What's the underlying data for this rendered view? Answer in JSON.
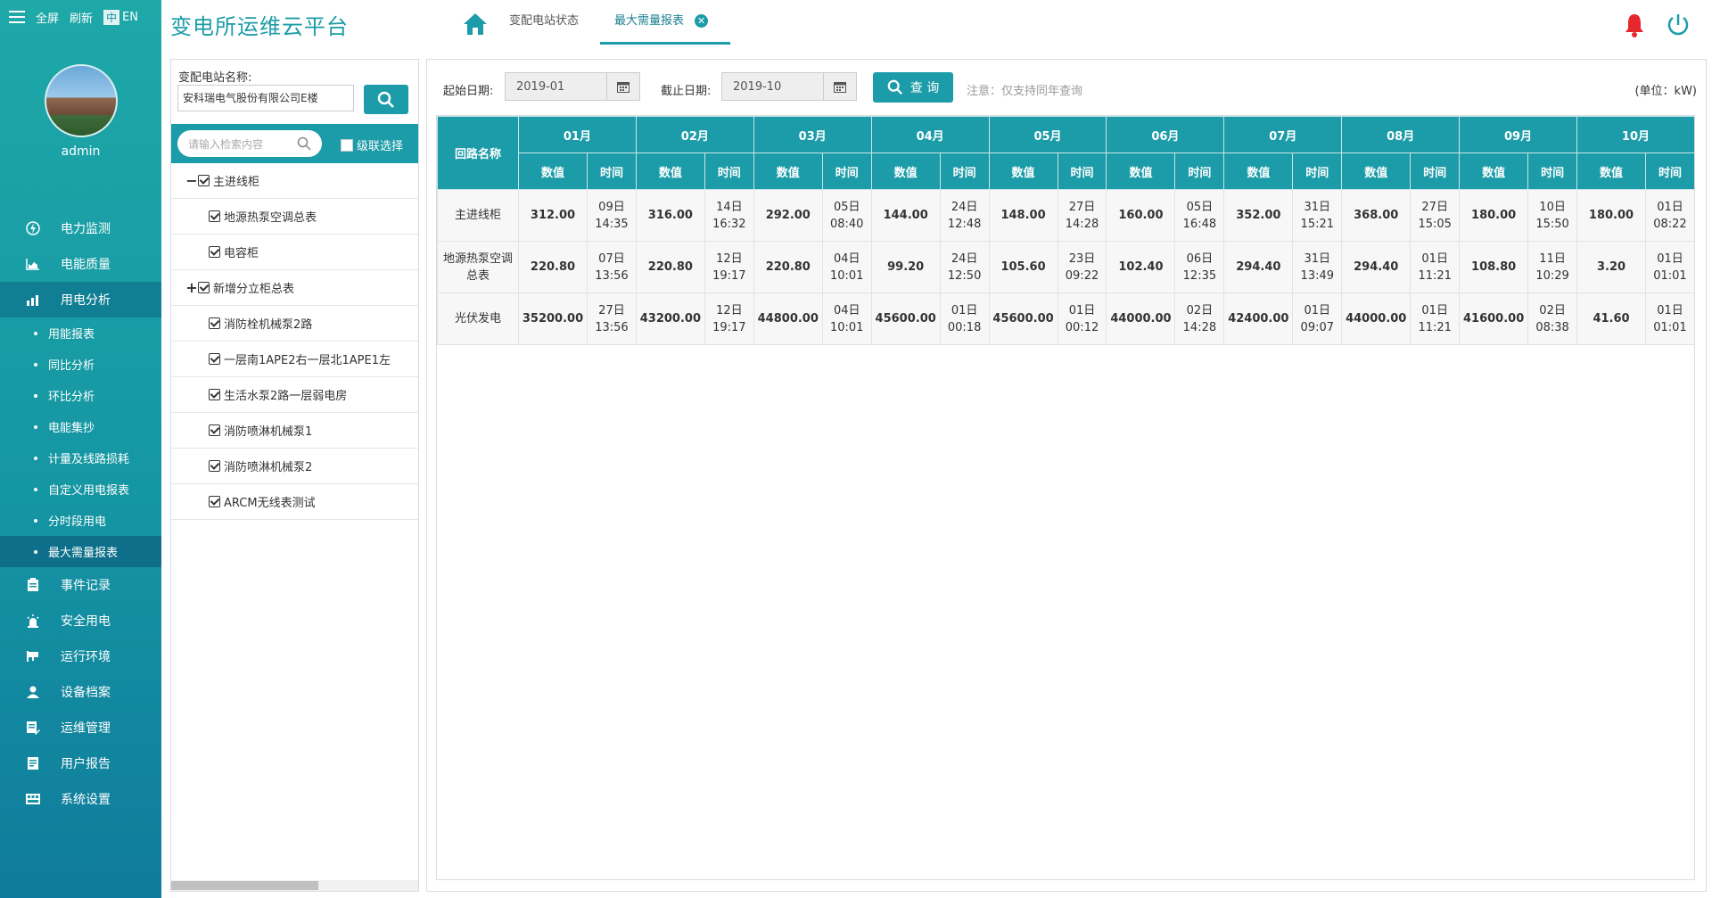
{
  "sidebar": {
    "fullscreen": "全屏",
    "refresh": "刷新",
    "lang_zh": "中",
    "lang_en": "EN",
    "username": "admin",
    "nav": [
      {
        "label": "电力监测",
        "icon": "lightning-icon"
      },
      {
        "label": "电能质量",
        "icon": "chart-area-icon"
      },
      {
        "label": "用电分析",
        "icon": "bar-chart-icon"
      }
    ],
    "sub": [
      "用能报表",
      "同比分析",
      "环比分析",
      "电能集抄",
      "计量及线路损耗",
      "自定义用电报表",
      "分时段用电",
      "最大需量报表"
    ],
    "nav2": [
      {
        "label": "事件记录",
        "icon": "clipboard-icon"
      },
      {
        "label": "安全用电",
        "icon": "alarm-light-icon"
      },
      {
        "label": "运行环境",
        "icon": "camera-icon"
      },
      {
        "label": "设备档案",
        "icon": "user-group-icon"
      },
      {
        "label": "运维管理",
        "icon": "edit-doc-icon"
      },
      {
        "label": "用户报告",
        "icon": "report-icon"
      },
      {
        "label": "系统设置",
        "icon": "keyboard-icon"
      }
    ]
  },
  "header": {
    "title": "变电所运维云平台",
    "tab1": "变配电站状态",
    "tab2": "最大需量报表",
    "accent": "#1c9ca8"
  },
  "tree": {
    "label": "变配电站名称:",
    "station": "安科瑞电气股份有限公司E楼",
    "search_placeholder": "请输入检索内容",
    "cascade": "级联选择",
    "nodes": [
      {
        "label": "主进线柜",
        "expander": "−",
        "level": 1
      },
      {
        "label": "地源热泵空调总表",
        "expander": "",
        "level": 2
      },
      {
        "label": "电容柜",
        "expander": "",
        "level": 2
      },
      {
        "label": "新增分立柜总表",
        "expander": "+",
        "level": 1
      },
      {
        "label": "消防栓机械泵2路",
        "expander": "",
        "level": 2
      },
      {
        "label": "一层南1APE2右一层北1APE1左",
        "expander": "",
        "level": 2
      },
      {
        "label": "生活水泵2路一层弱电房",
        "expander": "",
        "level": 2
      },
      {
        "label": "消防喷淋机械泵1",
        "expander": "",
        "level": 2
      },
      {
        "label": "消防喷淋机械泵2",
        "expander": "",
        "level": 2
      },
      {
        "label": "ARCM无线表测试",
        "expander": "",
        "level": 2
      }
    ]
  },
  "filter": {
    "start_label": "起始日期:",
    "start_value": "2019-01",
    "end_label": "截止日期:",
    "end_value": "2019-10",
    "query": "查 询",
    "note": "注意：仅支持同年查询",
    "unit": "(单位：kW)"
  },
  "table": {
    "name_header": "回路名称",
    "value_header": "数值",
    "time_header": "时间",
    "months": [
      "01月",
      "02月",
      "03月",
      "04月",
      "05月",
      "06月",
      "07月",
      "08月",
      "09月",
      "10月"
    ],
    "rows": [
      {
        "name": "主进线柜",
        "cells": [
          [
            "312.00",
            "09日",
            "14:35"
          ],
          [
            "316.00",
            "14日",
            "16:32"
          ],
          [
            "292.00",
            "05日",
            "08:40"
          ],
          [
            "144.00",
            "24日",
            "12:48"
          ],
          [
            "148.00",
            "27日",
            "14:28"
          ],
          [
            "160.00",
            "05日",
            "16:48"
          ],
          [
            "352.00",
            "31日",
            "15:21"
          ],
          [
            "368.00",
            "27日",
            "15:05"
          ],
          [
            "180.00",
            "10日",
            "15:50"
          ],
          [
            "180.00",
            "01日",
            "08:22"
          ]
        ]
      },
      {
        "name": "地源热泵空调总表",
        "cells": [
          [
            "220.80",
            "07日",
            "13:56"
          ],
          [
            "220.80",
            "12日",
            "19:17"
          ],
          [
            "220.80",
            "04日",
            "10:01"
          ],
          [
            "99.20",
            "24日",
            "12:50"
          ],
          [
            "105.60",
            "23日",
            "09:22"
          ],
          [
            "102.40",
            "06日",
            "12:35"
          ],
          [
            "294.40",
            "31日",
            "13:49"
          ],
          [
            "294.40",
            "01日",
            "11:21"
          ],
          [
            "108.80",
            "11日",
            "10:29"
          ],
          [
            "3.20",
            "01日",
            "01:01"
          ]
        ]
      },
      {
        "name": "光伏发电",
        "cells": [
          [
            "35200.00",
            "27日",
            "13:56"
          ],
          [
            "43200.00",
            "12日",
            "19:17"
          ],
          [
            "44800.00",
            "04日",
            "10:01"
          ],
          [
            "45600.00",
            "01日",
            "00:18"
          ],
          [
            "45600.00",
            "01日",
            "00:12"
          ],
          [
            "44000.00",
            "02日",
            "14:28"
          ],
          [
            "42400.00",
            "01日",
            "09:07"
          ],
          [
            "44000.00",
            "01日",
            "11:21"
          ],
          [
            "41600.00",
            "02日",
            "08:38"
          ],
          [
            "41.60",
            "01日",
            "01:01"
          ]
        ]
      }
    ]
  }
}
